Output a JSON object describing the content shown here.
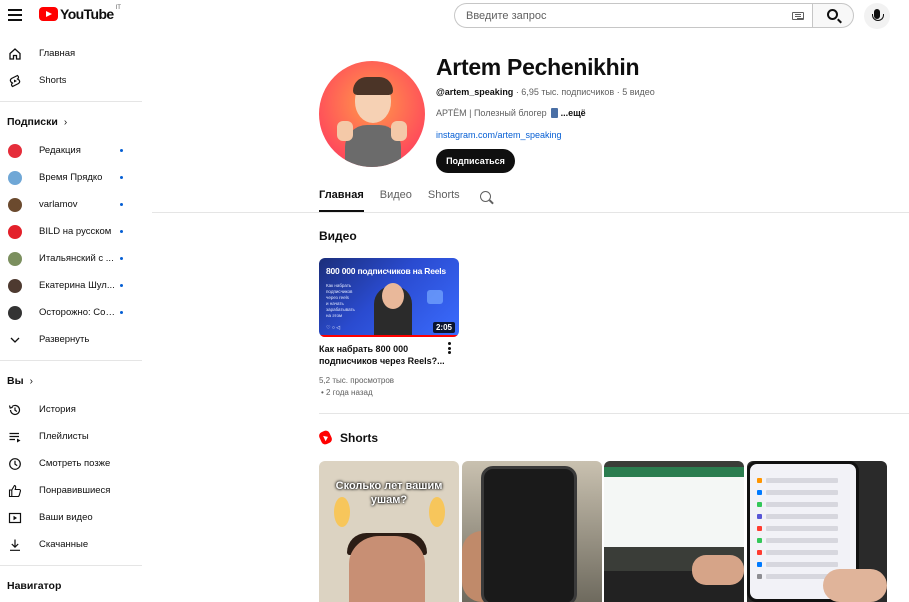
{
  "header": {
    "logo_text": "YouTube",
    "country_code": "IT",
    "search_placeholder": "Введите запрос"
  },
  "sidebar": {
    "main": [
      {
        "label": "Главная",
        "icon": "home-icon"
      },
      {
        "label": "Shorts",
        "icon": "shorts-icon"
      }
    ],
    "subscriptions_header": "Подписки",
    "subscriptions": [
      {
        "label": "Редакция",
        "color": "#e52d3a"
      },
      {
        "label": "Время Прядко",
        "color": "#6fa7d6"
      },
      {
        "label": "varlamov",
        "color": "#6b4a2e"
      },
      {
        "label": "BILD на русском",
        "color": "#e3202a"
      },
      {
        "label": "Итальянский с ...",
        "color": "#7b8f5e"
      },
      {
        "label": "Екатерина Шул...",
        "color": "#4e3a30"
      },
      {
        "label": "Осторожно: Соб...",
        "color": "#333333"
      }
    ],
    "expand_label": "Развернуть",
    "you_header": "Вы",
    "you_items": [
      {
        "label": "История",
        "icon": "history-icon"
      },
      {
        "label": "Плейлисты",
        "icon": "playlists-icon"
      },
      {
        "label": "Смотреть позже",
        "icon": "watch-later-icon"
      },
      {
        "label": "Понравившиеся",
        "icon": "like-icon"
      },
      {
        "label": "Ваши видео",
        "icon": "your-videos-icon"
      },
      {
        "label": "Скачанные",
        "icon": "download-icon"
      }
    ],
    "navigator_header": "Навигатор"
  },
  "channel": {
    "name": "Artem Pechenikhin",
    "handle": "@artem_speaking",
    "stats": " · 6,95 тыс. подписчиков · 5 видео",
    "description": "АРТЁМ | Полезный блогер",
    "more": "...ещё",
    "link": "instagram.com/artem_speaking",
    "subscribe_label": "Подписаться"
  },
  "tabs": [
    {
      "label": "Главная",
      "active": true
    },
    {
      "label": "Видео",
      "active": false
    },
    {
      "label": "Shorts",
      "active": false
    }
  ],
  "videos_section": {
    "title": "Видео",
    "video": {
      "thumb_title": "800 000 подписчиков на Reels",
      "thumb_subtitle": "Как набрать подписчиков через reels и начать зарабатывать на этом",
      "duration": "2:05",
      "title": "Как набрать 800 000 подписчиков через Reels?...",
      "views": "5,2 тыс. просмотров",
      "age": "• 2 года назад"
    }
  },
  "shorts_section": {
    "title": "Shorts",
    "short1_caption": "Сколько лет вашим ушам?"
  }
}
